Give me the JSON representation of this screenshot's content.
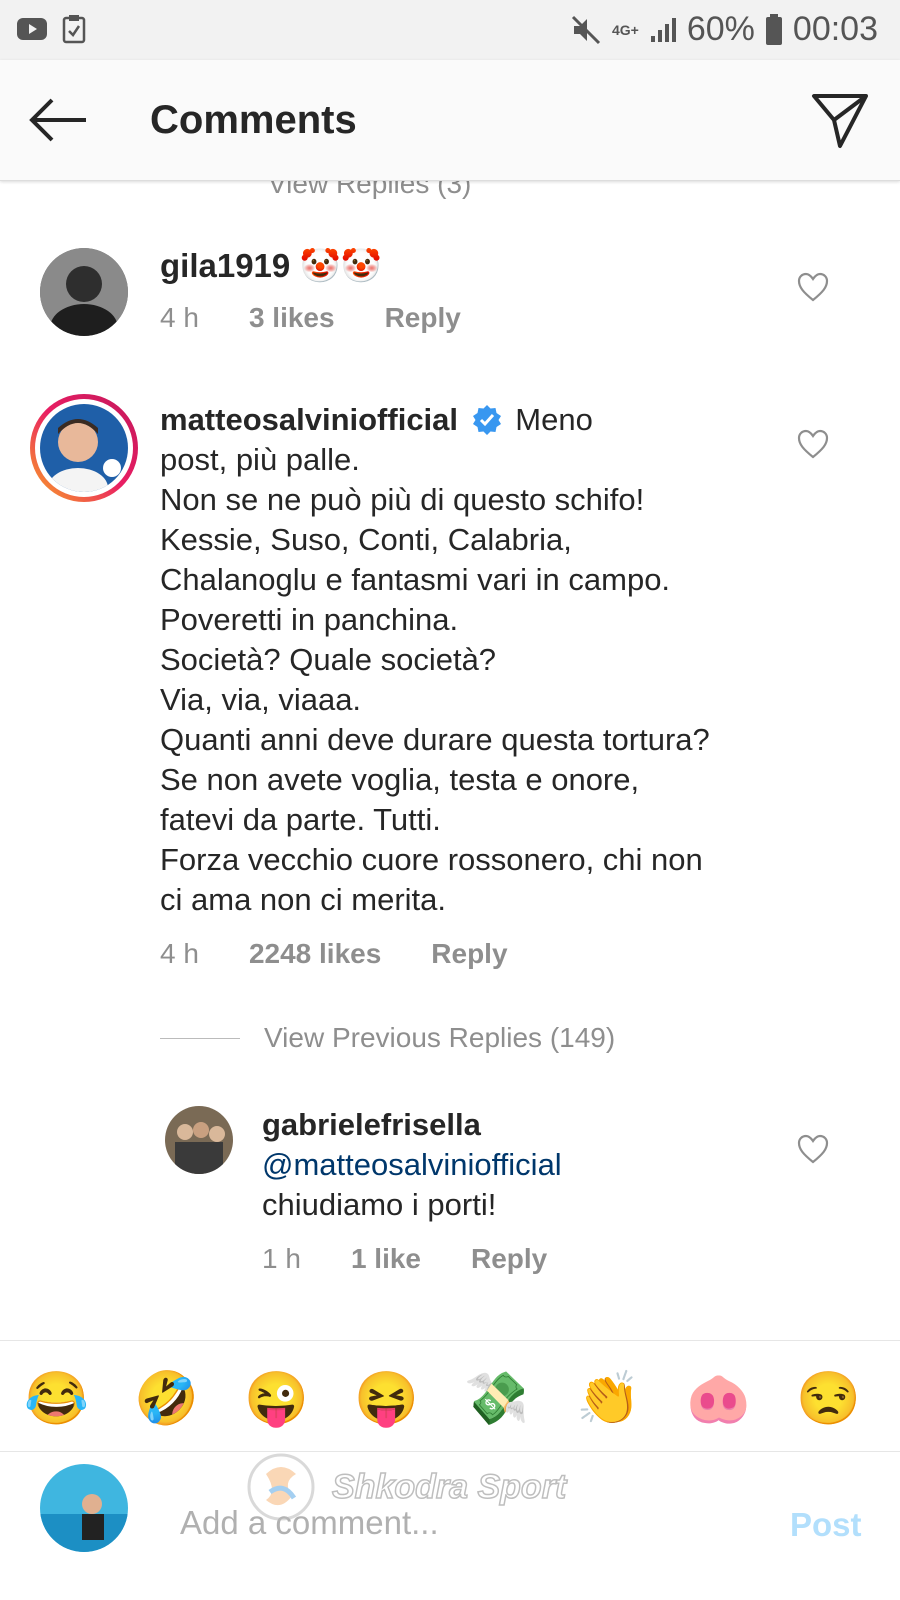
{
  "status_bar": {
    "network": "4G+",
    "battery": "60%",
    "time": "00:03"
  },
  "header": {
    "title": "Comments"
  },
  "cutoff_text": "View Replies (3)",
  "comments": [
    {
      "username": "gila1919",
      "emoji": "🤡🤡",
      "time": "4 h",
      "likes": "3 likes",
      "reply": "Reply"
    },
    {
      "username": "matteosalviniofficial",
      "text_lines": [
        "Meno",
        "post, più palle.",
        "Non se ne può più di questo schifo!",
        "Kessie, Suso, Conti, Calabria,",
        "Chalanoglu e fantasmi vari in campo.",
        "Poveretti in panchina.",
        "Società? Quale società?",
        "Via, via, viaaa.",
        "Quanti anni deve durare questa tortura?",
        "Se non avete voglia, testa e onore,",
        "fatevi da parte. Tutti.",
        "Forza vecchio cuore rossonero, chi non",
        "ci ama non ci merita."
      ],
      "time": "4 h",
      "likes": "2248 likes",
      "reply": "Reply"
    }
  ],
  "view_previous": "View Previous Replies (149)",
  "reply_comment": {
    "username": "gabrielefrisella",
    "mention": "@matteosalviniofficial",
    "text": "chiudiamo i porti!",
    "time": "1 h",
    "likes": "1 like",
    "reply": "Reply"
  },
  "emoji_bar": [
    "😂",
    "🤣",
    "😜",
    "😝",
    "💸",
    "👏",
    "🐽",
    "😒"
  ],
  "input": {
    "placeholder": "Add a comment...",
    "post_label": "Post"
  },
  "watermark": "Shkodra Sport",
  "colors": {
    "link_blue": "#00376b",
    "verified_blue": "#3897f0",
    "post_disabled": "#b2dffc",
    "meta_gray": "#8e8e8e"
  }
}
